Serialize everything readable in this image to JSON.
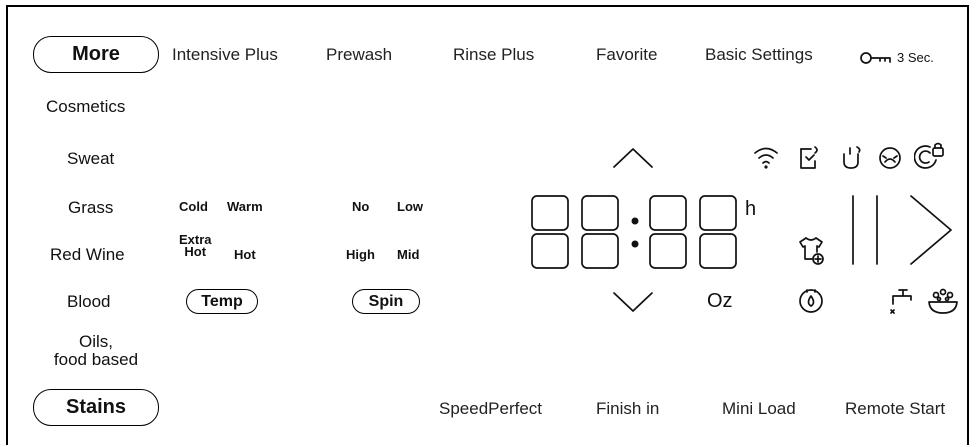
{
  "top_bar": {
    "more_label": "More",
    "items": [
      "Intensive Plus",
      "Prewash",
      "Rinse Plus",
      "Favorite",
      "Basic Settings"
    ],
    "lock_hint": "3 Sec."
  },
  "stains": {
    "items": [
      "Cosmetics",
      "Sweat",
      "Grass",
      "Red Wine",
      "Blood"
    ],
    "oils_line1": "Oils,",
    "oils_line2": "food based",
    "button_label": "Stains"
  },
  "temp": {
    "cold": "Cold",
    "warm": "Warm",
    "extra_hot_line1": "Extra",
    "extra_hot_line2": "Hot",
    "hot": "Hot",
    "button_label": "Temp"
  },
  "spin": {
    "no": "No",
    "low": "Low",
    "high": "High",
    "mid": "Mid",
    "button_label": "Spin"
  },
  "display": {
    "hours_unit": "h",
    "weight_unit": "Oz"
  },
  "bottom_bar": {
    "items": [
      "SpeedPerfect",
      "Finish in",
      "Mini Load",
      "Remote Start"
    ]
  },
  "icons": {
    "status": [
      "wifi-icon",
      "phone-connect-icon",
      "drain-hose-icon",
      "drum-clean-icon",
      "child-lock-icon"
    ],
    "others": [
      "lock-key-icon",
      "chevron-up-icon",
      "chevron-down-icon",
      "add-garment-icon",
      "pause-icon",
      "play-icon",
      "dosing-icon",
      "water-tap-icon",
      "basin-icon"
    ]
  }
}
